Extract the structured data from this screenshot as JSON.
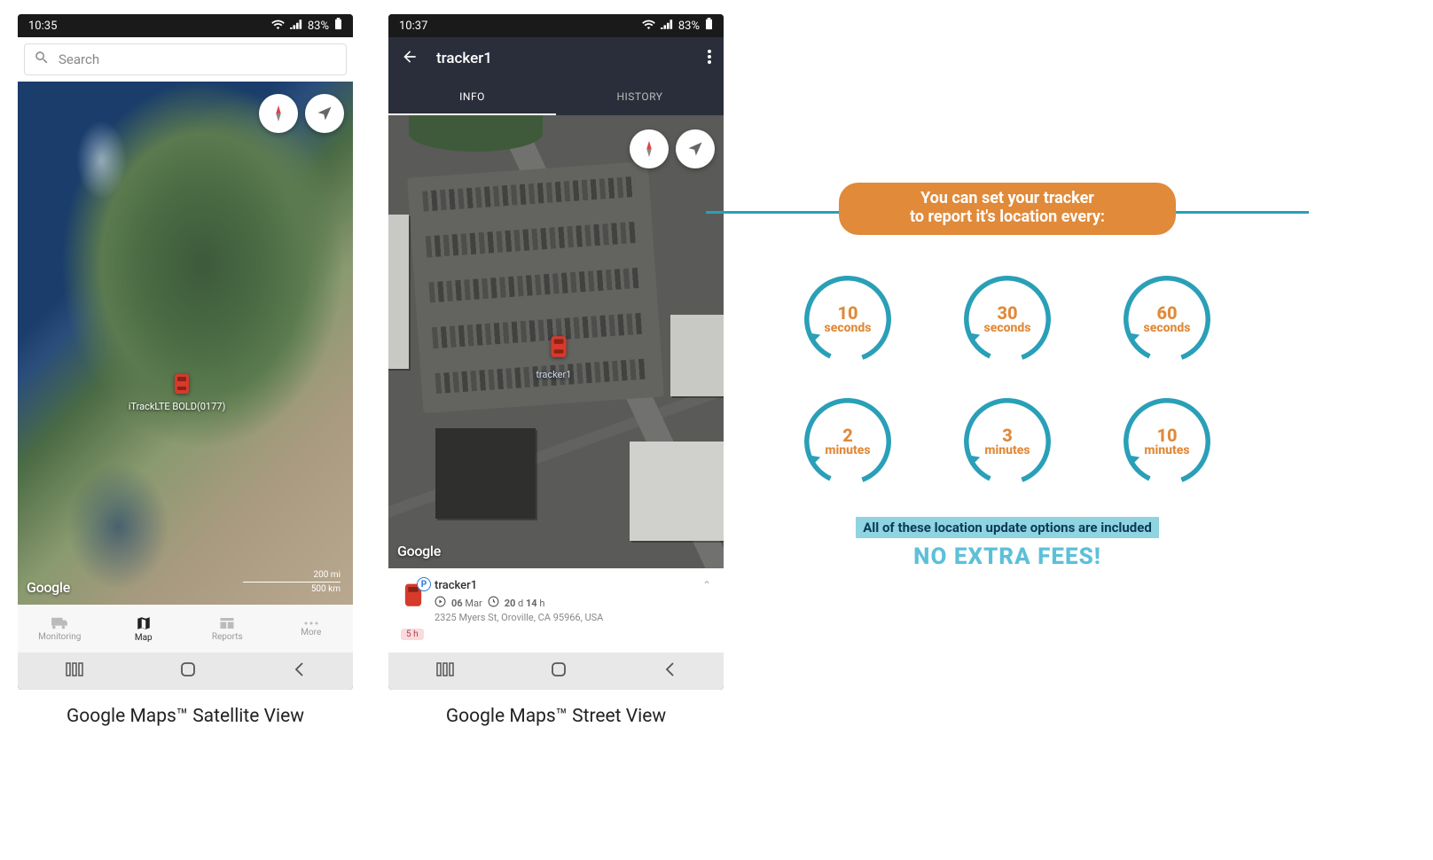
{
  "phone1": {
    "time": "10:35",
    "battery": "83%",
    "search_placeholder": "Search",
    "marker_label": "iTrackLTE BOLD(0177)",
    "google": "Google",
    "scale_mi": "200 mi",
    "scale_km": "500 km",
    "nav": {
      "monitoring": "Monitoring",
      "map": "Map",
      "reports": "Reports",
      "more": "More"
    },
    "caption": "Google Maps™ Satellite View"
  },
  "phone2": {
    "time": "10:37",
    "battery": "83%",
    "title": "tracker1",
    "tab_info": "INFO",
    "tab_history": "HISTORY",
    "google": "Google",
    "marker_label": "tracker1",
    "panel": {
      "name": "tracker1",
      "p": "P",
      "date_num": "06",
      "date_mon": "Mar",
      "dur_d": "20",
      "dur_d_lbl": "d",
      "dur_h": "14",
      "dur_h_lbl": "h",
      "address": "2325 Myers St, Oroville, CA 95966, USA",
      "badge": "5 h"
    },
    "caption": "Google Maps™ Street View"
  },
  "promo": {
    "banner_l1": "You can set your tracker",
    "banner_l2": "to report it's location every:",
    "intervals": [
      {
        "num": "10",
        "unit": "seconds"
      },
      {
        "num": "30",
        "unit": "seconds"
      },
      {
        "num": "60",
        "unit": "seconds"
      },
      {
        "num": "2",
        "unit": "minutes"
      },
      {
        "num": "3",
        "unit": "minutes"
      },
      {
        "num": "10",
        "unit": "minutes"
      }
    ],
    "note_l1": "All of these location update options are included",
    "note_l2": "NO EXTRA FEES!"
  }
}
